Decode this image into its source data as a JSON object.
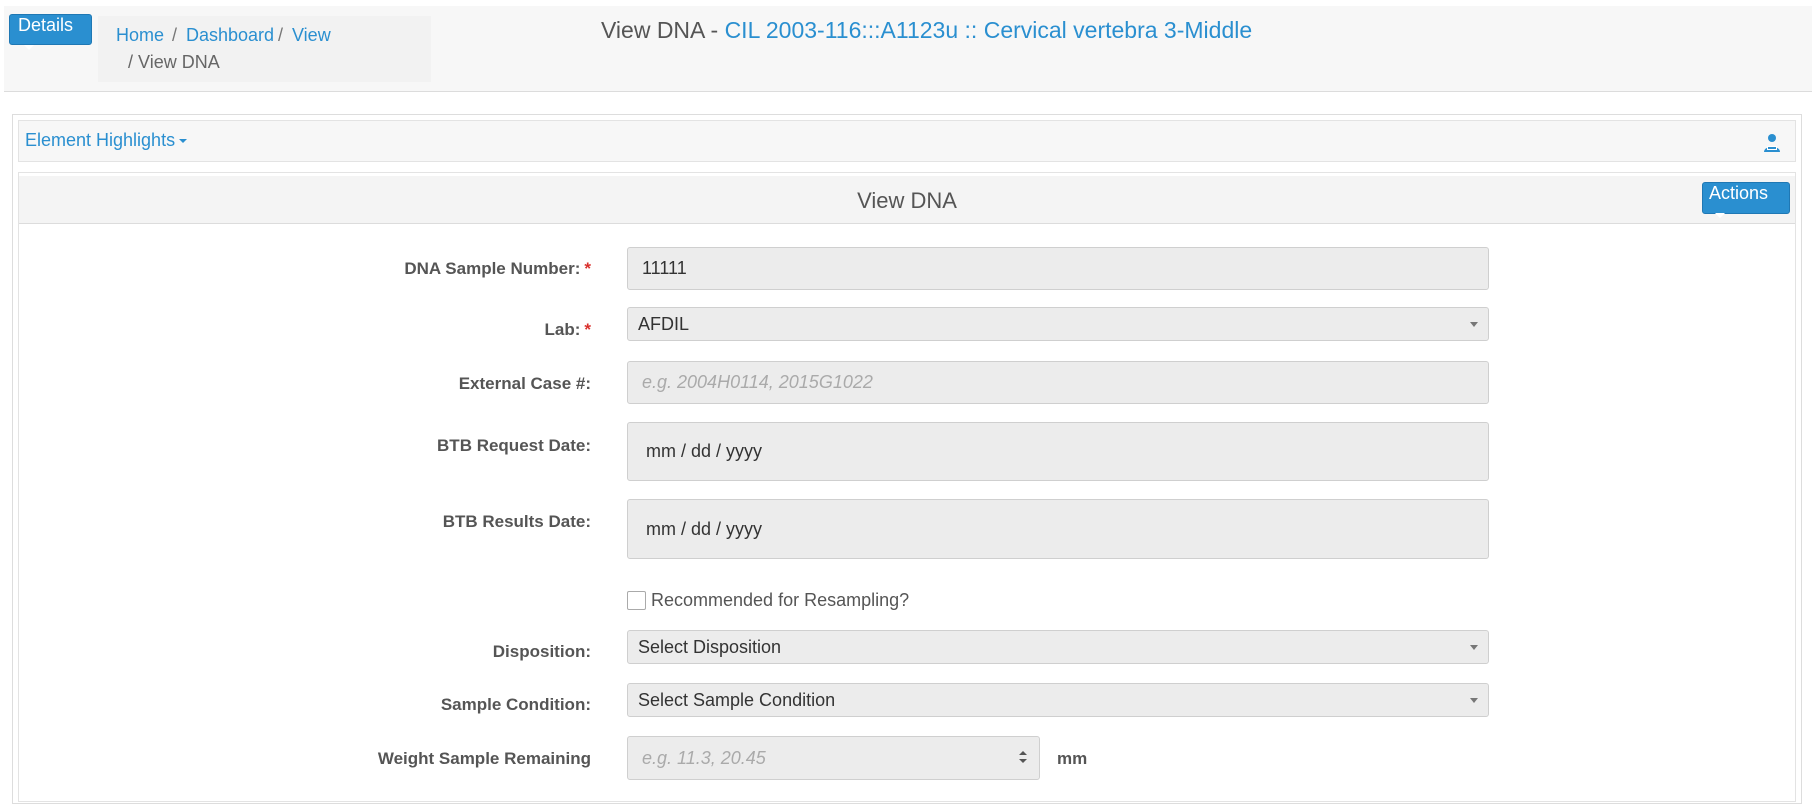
{
  "header": {
    "details_label": "Details",
    "breadcrumb": {
      "home": "Home",
      "dashboard": "Dashboard",
      "view": "View",
      "active": "View DNA"
    },
    "title_prefix": "View DNA - ",
    "title_link": "CIL 2003-116:::A1123u :: Cervical vertebra 3-Middle"
  },
  "highlights": {
    "label": "Element Highlights",
    "icon": "person-icon"
  },
  "panel": {
    "title": "View DNA",
    "actions_label": "Actions"
  },
  "form": {
    "dna_sample_number": {
      "label": "DNA Sample Number:",
      "required": "*",
      "value": "11111"
    },
    "lab": {
      "label": "Lab:",
      "required": "*",
      "value": "AFDIL"
    },
    "external_case": {
      "label": "External Case #:",
      "placeholder": "e.g. 2004H0114, 2015G1022"
    },
    "btb_request_date": {
      "label": "BTB Request Date:",
      "value": "mm / dd / yyyy"
    },
    "btb_results_date": {
      "label": "BTB Results Date:",
      "value": "mm / dd / yyyy"
    },
    "resampling": {
      "label": "Recommended for Resampling?",
      "checked": false
    },
    "disposition": {
      "label": "Disposition:",
      "value": "Select Disposition"
    },
    "sample_condition": {
      "label": "Sample Condition:",
      "value": "Select Sample Condition"
    },
    "weight_remaining": {
      "label": "Weight Sample Remaining",
      "placeholder": "e.g. 11.3, 20.45",
      "unit": "mm"
    }
  },
  "colors": {
    "accent": "#2a8fd0",
    "required": "#d9302c"
  }
}
